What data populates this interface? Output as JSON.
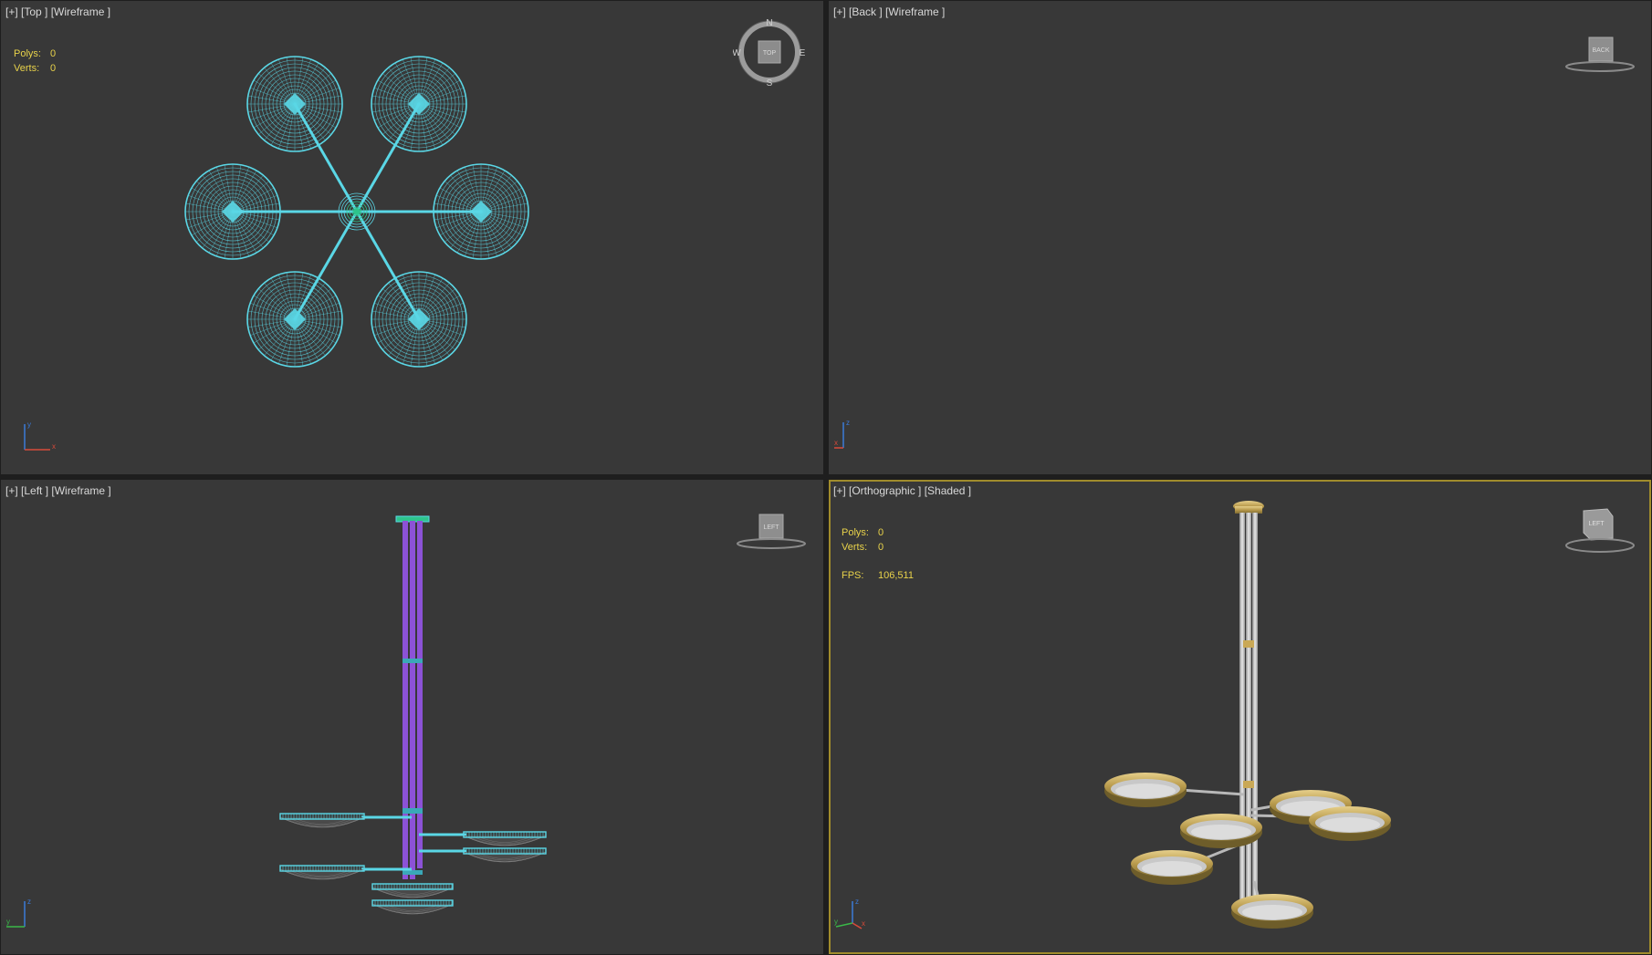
{
  "viewports": {
    "top": {
      "label": "[+] [Top ] [Wireframe ]",
      "polys_label": "Polys:",
      "polys": "0",
      "verts_label": "Verts:",
      "verts": "0",
      "cube": "TOP",
      "compass": {
        "n": "N",
        "s": "S",
        "e": "E",
        "w": "W"
      }
    },
    "back": {
      "label": "[+] [Back ] [Wireframe ]",
      "cube": "BACK"
    },
    "left": {
      "label": "[+] [Left ] [Wireframe ]",
      "cube": "LEFT"
    },
    "persp": {
      "label": "[+] [Orthographic ] [Shaded ]",
      "polys_label": "Polys:",
      "polys": "0",
      "verts_label": "Verts:",
      "verts": "0",
      "fps_label": "FPS:",
      "fps": "106,511",
      "cube": "LEFT"
    }
  },
  "axes": {
    "top": [
      "y",
      "x"
    ],
    "back": [
      "z",
      "x"
    ],
    "left": [
      "z",
      "y"
    ],
    "persp": [
      "z",
      "y",
      "x"
    ]
  },
  "colors": {
    "wire": "#5ad7e6",
    "rod": "#8c52d6",
    "accent_hub": "#2ec48c",
    "brass": "#c9a856",
    "active_border": "#a08c2c",
    "stats": "#e8d24a",
    "viewport_bg": "#383838"
  }
}
